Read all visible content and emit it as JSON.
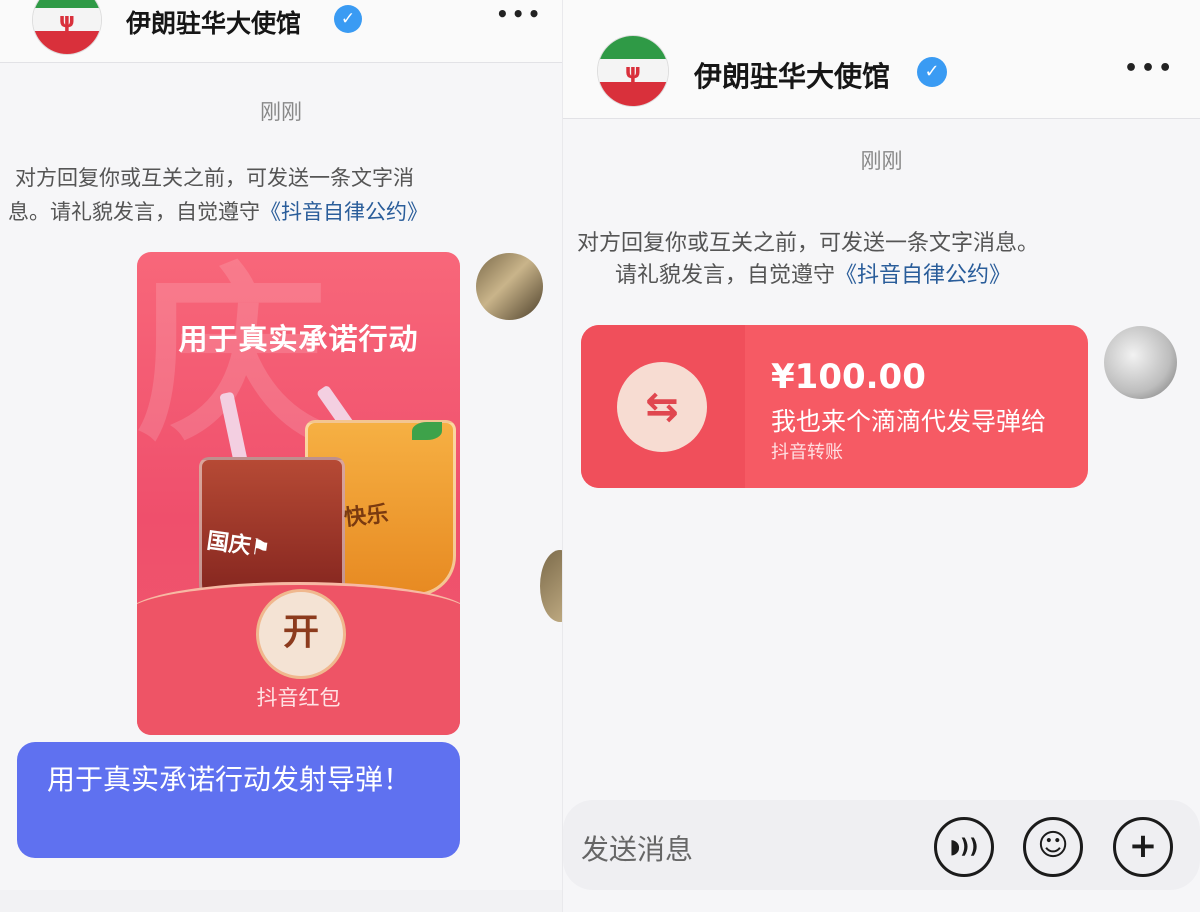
{
  "left": {
    "header": {
      "name": "伊朗驻华大使馆",
      "verified": "✓",
      "more": "•••",
      "flag_emblem": "ψ"
    },
    "timestamp": "刚刚",
    "notice_line1": "对方回复你或互关之前，可发送一条文字消",
    "notice_line2_prefix": "息。请礼貌发言，自觉遵守",
    "notice_link": "《抖音自律公约》",
    "envelope": {
      "title": "用于真实承诺行动",
      "cup_label_1": "国庆⚑",
      "cup_label_2": "快乐",
      "open_label": "开",
      "footer": "抖音红包",
      "watermark": "庆"
    },
    "message": "用于真实承诺行动发射导弹！"
  },
  "right": {
    "header": {
      "name": "伊朗驻华大使馆",
      "verified": "✓",
      "more": "•••",
      "flag_emblem": "ψ"
    },
    "timestamp": "刚刚",
    "notice_line1": "对方回复你或互关之前，可发送一条文字消息。",
    "notice_line2_prefix": "请礼貌发言，自觉遵守",
    "notice_link": "《抖音自律公约》",
    "transfer": {
      "icon": "⇆",
      "amount": "¥100.00",
      "message": "我也来个滴滴代发导弹给",
      "source": "抖音转账"
    },
    "input_placeholder": "发送消息",
    "buttons": {
      "voice": "◗))",
      "emoji": "☺",
      "plus": "+"
    }
  },
  "colors": {
    "accent_blue": "#5f71f0",
    "red_packet": "#ef4f6c",
    "transfer_red": "#f65a64",
    "verify_blue": "#3a9bf3"
  }
}
